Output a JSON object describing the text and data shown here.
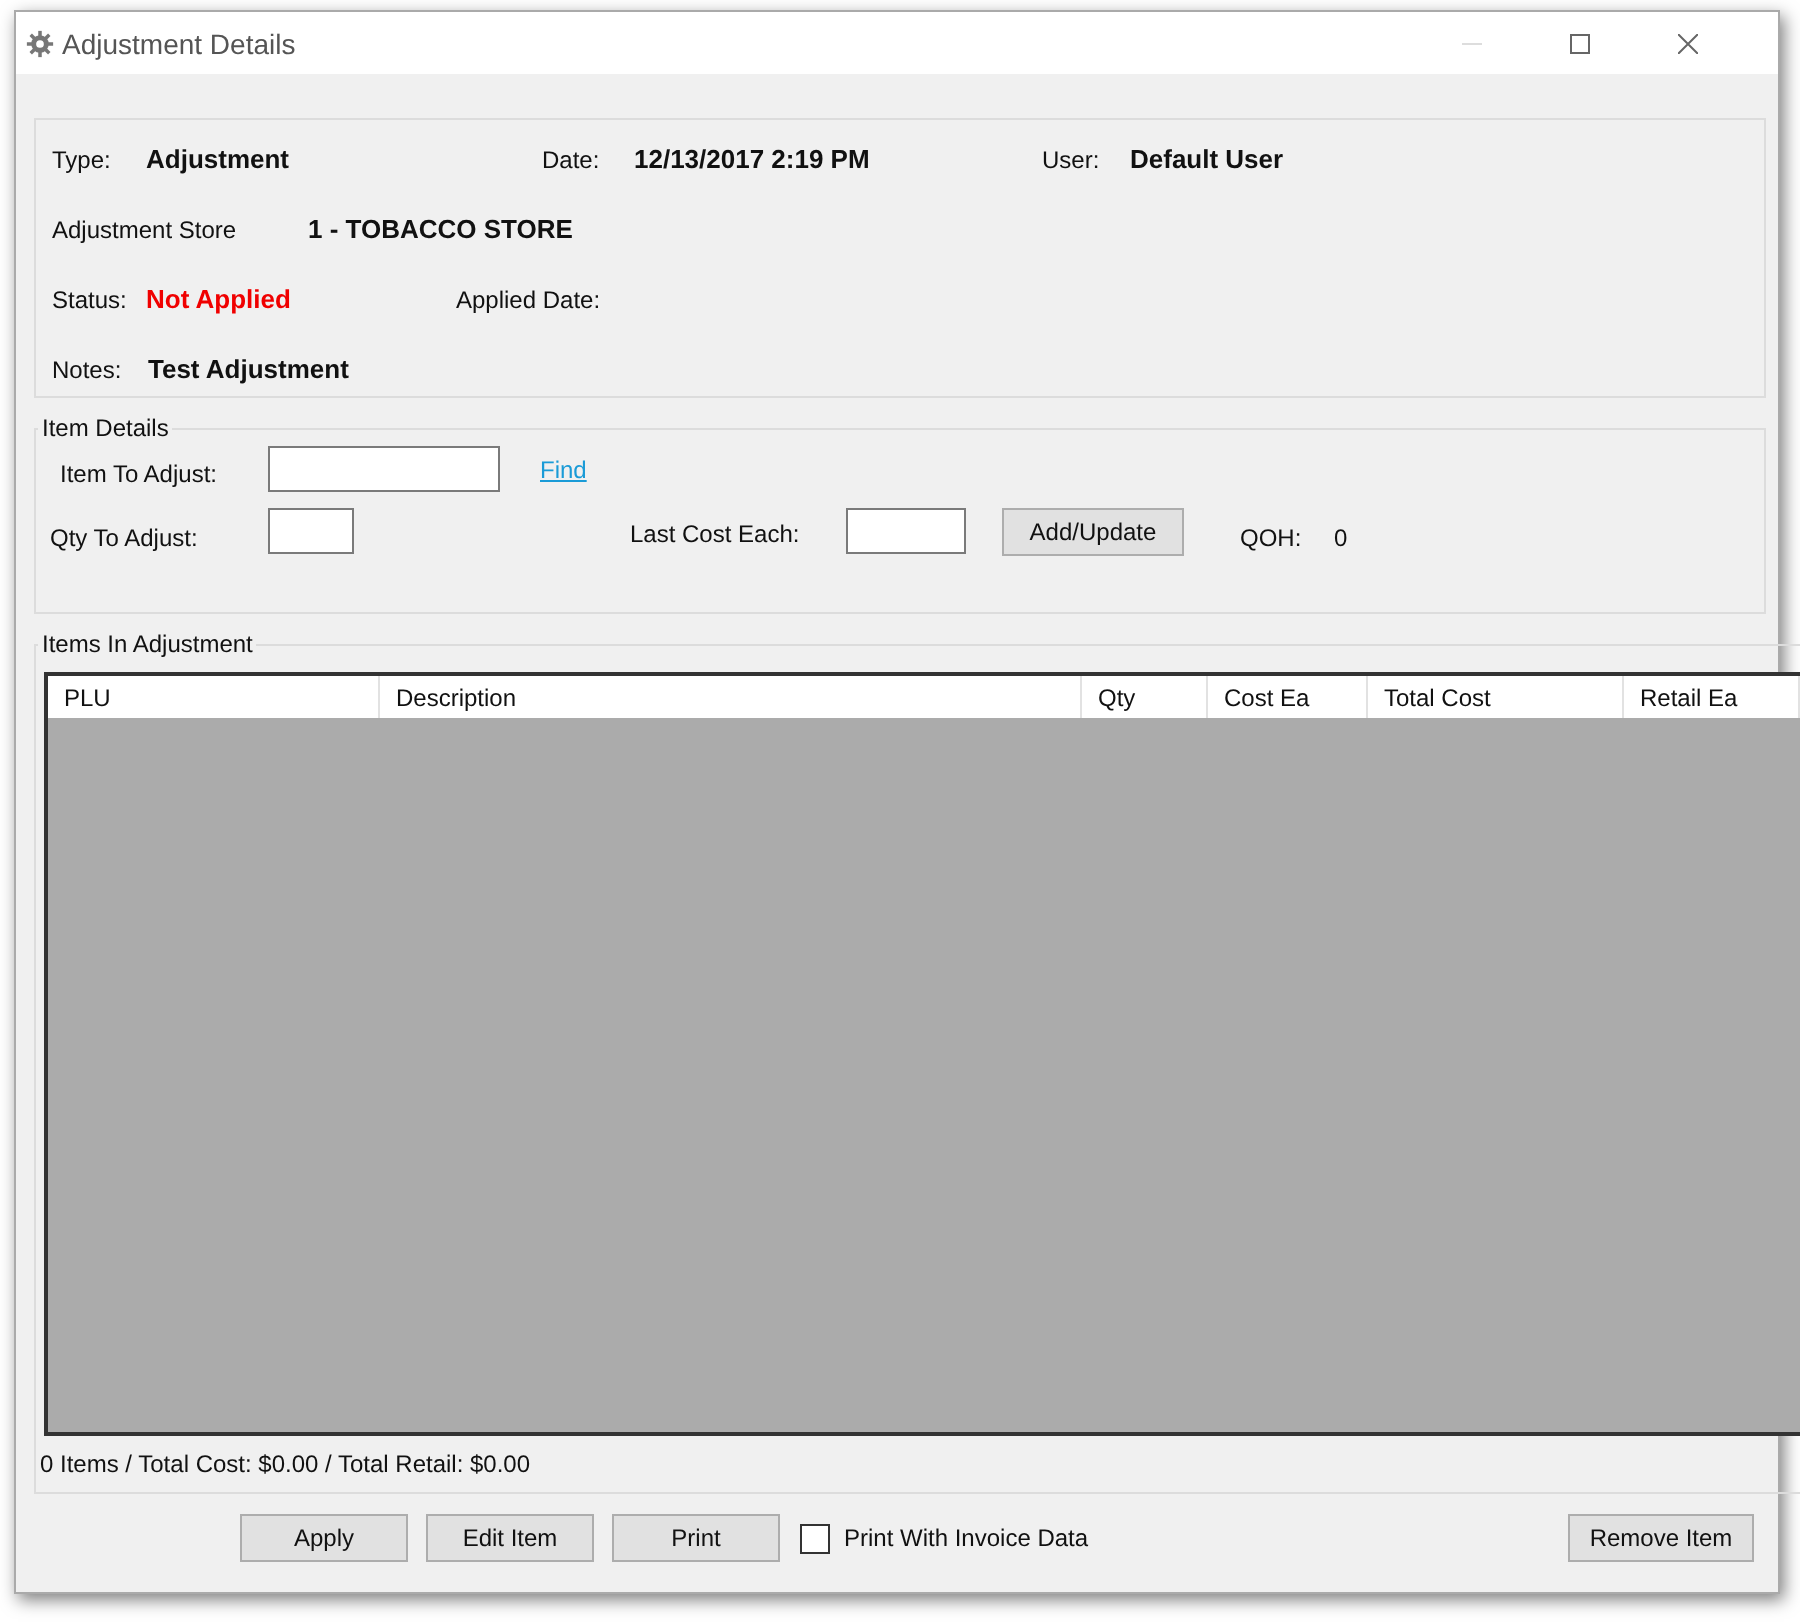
{
  "window": {
    "title": "Adjustment Details"
  },
  "header": {
    "rows": [
      [
        {
          "label": "Type:",
          "value": "Adjustment",
          "kind": "normal"
        },
        {
          "label": "Date:",
          "value": "12/13/2017 2:19 PM",
          "kind": "normal"
        },
        {
          "label": "User:",
          "value": "Default User",
          "kind": "normal"
        }
      ],
      [
        {
          "label": "Adjustment Store",
          "value": "1 - TOBACCO STORE",
          "kind": "normal"
        }
      ],
      [
        {
          "label": "Status:",
          "value": "Not Applied",
          "kind": "alert"
        },
        {
          "label": "Applied Date:"
        }
      ],
      [
        {
          "label": "Notes:",
          "value": "Test Adjustment",
          "kind": "normal"
        }
      ]
    ]
  },
  "item_details": {
    "legend": "Item Details",
    "item_label": "Item To Adjust:",
    "find_link": "Find",
    "qty_label": "Qty To Adjust:",
    "cost_label": "Last Cost Each:",
    "add_button": "Add/Update",
    "qoh_label": "QOH:",
    "qoh_value": "0"
  },
  "items": {
    "legend": "Items In Adjustment",
    "columns": [
      "PLU",
      "Description",
      "Qty",
      "Cost Ea",
      "Total Cost",
      "Retail Ea"
    ],
    "summary": "0 Items / Total Cost: $0.00 / Total Retail: $0.00"
  },
  "buttons": [
    "Apply",
    "Edit Item",
    "Print"
  ],
  "print_invoice": {
    "label": "Print With Invoice Data",
    "checked": false
  },
  "remove_button": "Remove Item"
}
